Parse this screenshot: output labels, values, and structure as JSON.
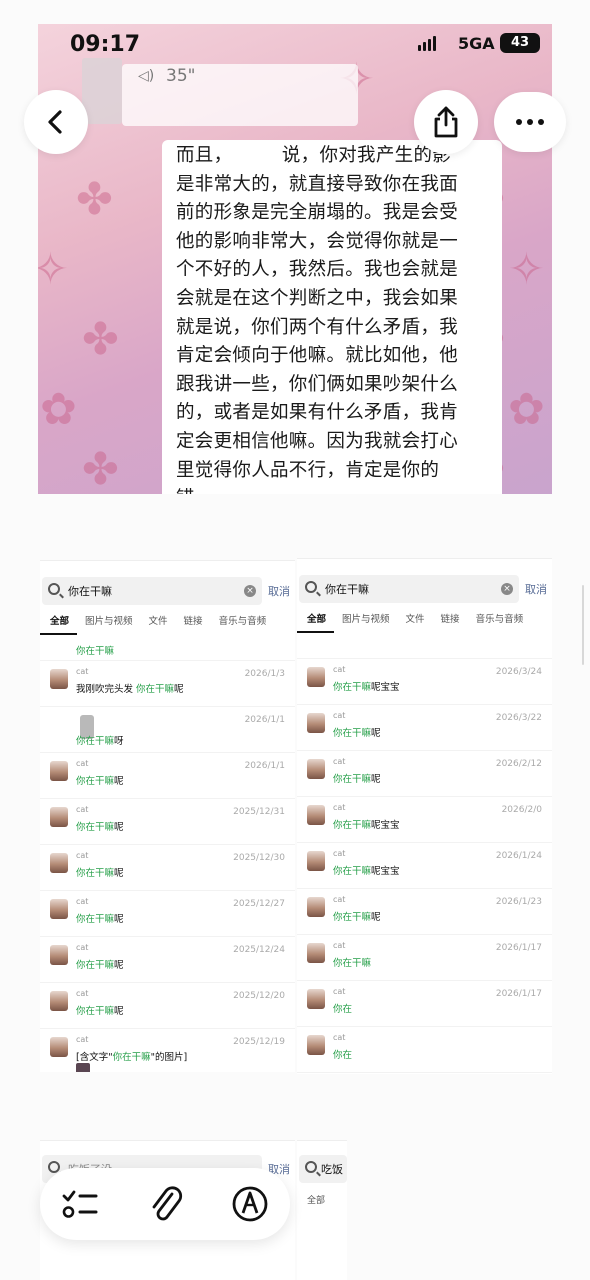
{
  "status_bar": {
    "time": "09:17",
    "network": "5GA",
    "battery": "43"
  },
  "voice_message": {
    "duration": "35\""
  },
  "transcript": {
    "lines": [
      "而且，        说，你对我产生的影",
      "是非常大的，就直接导致你在我面",
      "前的形象是完全崩塌的。我是会受",
      "他的影响非常大，会觉得你就是一",
      "个不好的人，我然后。我也会就是",
      "会就是在这个判断之中，我会如果",
      "就是说，你们两个有什么矛盾，我",
      "肯定会倾向于他嘛。就比如他，他",
      "跟我讲一些，你们俩如果吵架什么",
      "的，或者是如果有什么矛盾，我肯",
      "定会更相信他嘛。因为我就会打心",
      "里觉得你人品不行，肯定是你的",
      "错。"
    ]
  },
  "search_left": {
    "query": "你在干嘛",
    "cancel": "取消",
    "tabs": [
      "全部",
      "图片与视频",
      "文件",
      "链接",
      "音乐与音频"
    ],
    "results": [
      {
        "name": "",
        "pre": "",
        "hl": "你在干嘛",
        "post": "",
        "date": "",
        "partial": true
      },
      {
        "name": "cat",
        "pre": "我刚吹完头发 ",
        "hl": "你在干嘛",
        "post": "呢",
        "date": "2026/1/3"
      },
      {
        "name": "",
        "pre": "",
        "hl": "你在干嘛",
        "post": "呀",
        "date": "2026/1/1",
        "blur": true
      },
      {
        "name": "cat",
        "pre": "",
        "hl": "你在干嘛",
        "post": "呢",
        "date": "2026/1/1"
      },
      {
        "name": "cat",
        "pre": "",
        "hl": "你在干嘛",
        "post": "呢",
        "date": "2025/12/31"
      },
      {
        "name": "cat",
        "pre": "",
        "hl": "你在干嘛",
        "post": "呢",
        "date": "2025/12/30"
      },
      {
        "name": "cat",
        "pre": "",
        "hl": "你在干嘛",
        "post": "呢",
        "date": "2025/12/27"
      },
      {
        "name": "cat",
        "pre": "",
        "hl": "你在干嘛",
        "post": "呢",
        "date": "2025/12/24"
      },
      {
        "name": "cat",
        "pre": "",
        "hl": "你在干嘛",
        "post": "呢",
        "date": "2025/12/20"
      },
      {
        "name": "cat",
        "pre": "[含文字\"",
        "hl": "你在干嘛",
        "post": "\"的图片]",
        "date": "2025/12/19",
        "thumb": true
      }
    ]
  },
  "search_right": {
    "query": "你在干嘛",
    "cancel": "取消",
    "tabs": [
      "全部",
      "图片与视频",
      "文件",
      "链接",
      "音乐与音频"
    ],
    "results": [
      {
        "name": "",
        "pre": "",
        "hl": "",
        "post": "",
        "date": "",
        "partial": true
      },
      {
        "name": "cat",
        "pre": "",
        "hl": "你在干嘛",
        "post": "呢宝宝",
        "date": "2026/3/24"
      },
      {
        "name": "cat",
        "pre": "",
        "hl": "你在干嘛",
        "post": "呢",
        "date": "2026/3/22"
      },
      {
        "name": "cat",
        "pre": "",
        "hl": "你在干嘛",
        "post": "呢",
        "date": "2026/2/12"
      },
      {
        "name": "cat",
        "pre": "",
        "hl": "你在干嘛",
        "post": "呢宝宝",
        "date": "2026/2/0"
      },
      {
        "name": "cat",
        "pre": "",
        "hl": "你在干嘛",
        "post": "呢宝宝",
        "date": "2026/1/24"
      },
      {
        "name": "cat",
        "pre": "",
        "hl": "你在干嘛",
        "post": "呢",
        "date": "2026/1/23"
      },
      {
        "name": "cat",
        "pre": "",
        "hl": "你在干嘛",
        "post": "",
        "date": "2026/1/17"
      },
      {
        "name": "cat",
        "pre": "",
        "hl": "你在",
        "post": "",
        "date": "2026/1/17"
      },
      {
        "name": "cat",
        "pre": "",
        "hl": "你在",
        "post": "",
        "date": ""
      }
    ]
  },
  "search_bottom_left": {
    "query": "吃饭了没",
    "cancel": "取消"
  },
  "search_bottom_right": {
    "query": "吃饭",
    "tab": "全部"
  }
}
